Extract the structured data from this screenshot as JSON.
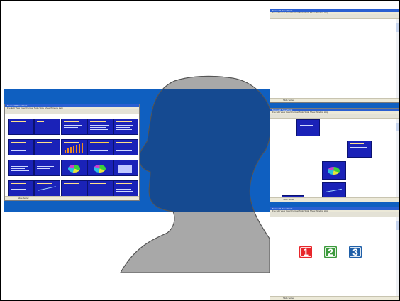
{
  "scene": {
    "description_role": "silhouette presenter with slide-show windows",
    "colors": {
      "band": "#0f5fc0",
      "head_fill": "#a8a8a8",
      "head_overlay": "#154a91",
      "slide_blue": "#1a22b8",
      "btn_1": "#e8262b",
      "btn_2": "#3c9a3c",
      "btn_3": "#1f5fa8"
    }
  },
  "windows": {
    "sorter": {
      "title": "Microsoft PowerPoint",
      "menu": "File  Edit  View  Insert  Format  Tools  Slide Show  Window  Help",
      "status": "Slide Sorter"
    },
    "blank": {
      "title": "Microsoft PowerPoint",
      "menu": "File  Edit  View  Insert  Format  Tools  Slide Show  Window  Help",
      "status": "Slide Sorter"
    },
    "scattered": {
      "title": "Microsoft PowerPoint",
      "menu": "File  Edit  View  Insert  Format  Tools  Slide Show  Window  Help",
      "status": "Slide Sorter"
    },
    "numbers": {
      "title": "Microsoft PowerPoint",
      "menu": "File  Edit  View  Insert  Format  Tools  Slide Show  Window  Help",
      "status": "Slide Sorter"
    }
  },
  "buttons": [
    {
      "label": "1",
      "color": "#e8262b"
    },
    {
      "label": "2",
      "color": "#3c9a3c"
    },
    {
      "label": "3",
      "color": "#1f5fa8"
    }
  ]
}
